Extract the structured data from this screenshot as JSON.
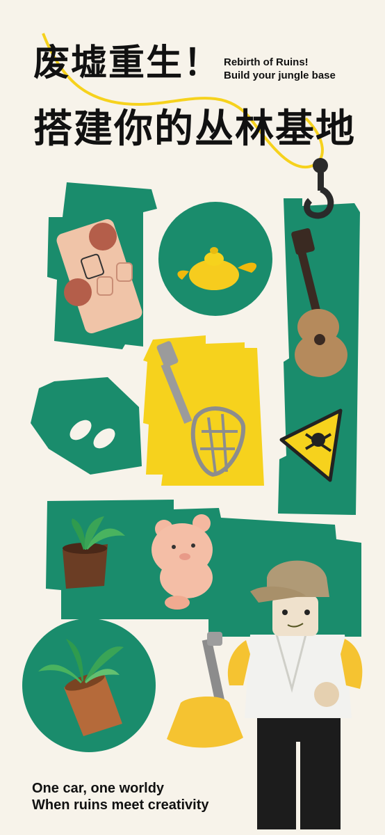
{
  "colors": {
    "background": "#f7f3ea",
    "green": "#1a8c6c",
    "yellow": "#f6d21d",
    "text": "#111111"
  },
  "header": {
    "title_zh_line1": "废墟重生！",
    "title_zh_line2": "搭建你的丛林基地",
    "title_en_line1": "Rebirth of Ruins!",
    "title_en_line2": "Build your jungle base"
  },
  "footer": {
    "line1": "One car, one worldy",
    "line2": "When ruins meet creativity"
  },
  "items": {
    "boombox": "boombox-brick",
    "lamp": "magic-lamp",
    "guitar": "guitar",
    "hook": "crane-hook",
    "net": "fishing-net",
    "eyes": "eyes-tile",
    "warning": "poison-warning-sign",
    "plant1": "potted-plant",
    "bear": "teddy-bear",
    "plant2": "potted-palm",
    "figure": "minifigure-with-broom",
    "broom": "broom"
  }
}
